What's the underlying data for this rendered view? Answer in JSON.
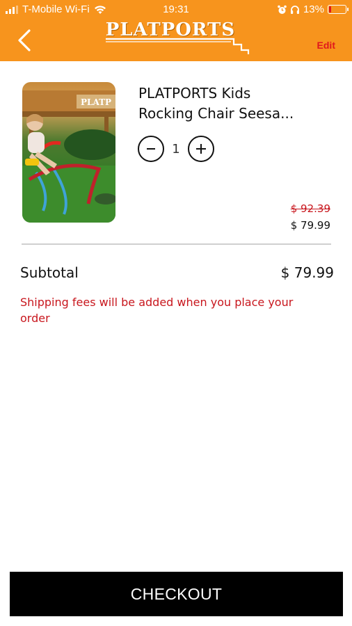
{
  "status_bar": {
    "carrier": "T-Mobile Wi-Fi",
    "time": "19:31",
    "battery": "13%",
    "battery_level": 0.13
  },
  "header": {
    "logo_text": "PLATPORTS",
    "edit_label": "Edit",
    "background_color": "#f7941d"
  },
  "cart_item": {
    "title": "PLATPORTS Kids\nRocking Chair Seesa...",
    "quantity": "1",
    "original_price": "$ 92.39",
    "sale_price": "$ 79.99",
    "image_sign_text": "PLATP"
  },
  "summary": {
    "subtotal_label": "Subtotal",
    "subtotal_value": "$ 79.99",
    "shipping_note": "Shipping fees will be added when you place your order"
  },
  "checkout": {
    "label": "CHECKOUT"
  },
  "colors": {
    "accent_red": "#c8161d",
    "brand_orange": "#f7941d"
  }
}
